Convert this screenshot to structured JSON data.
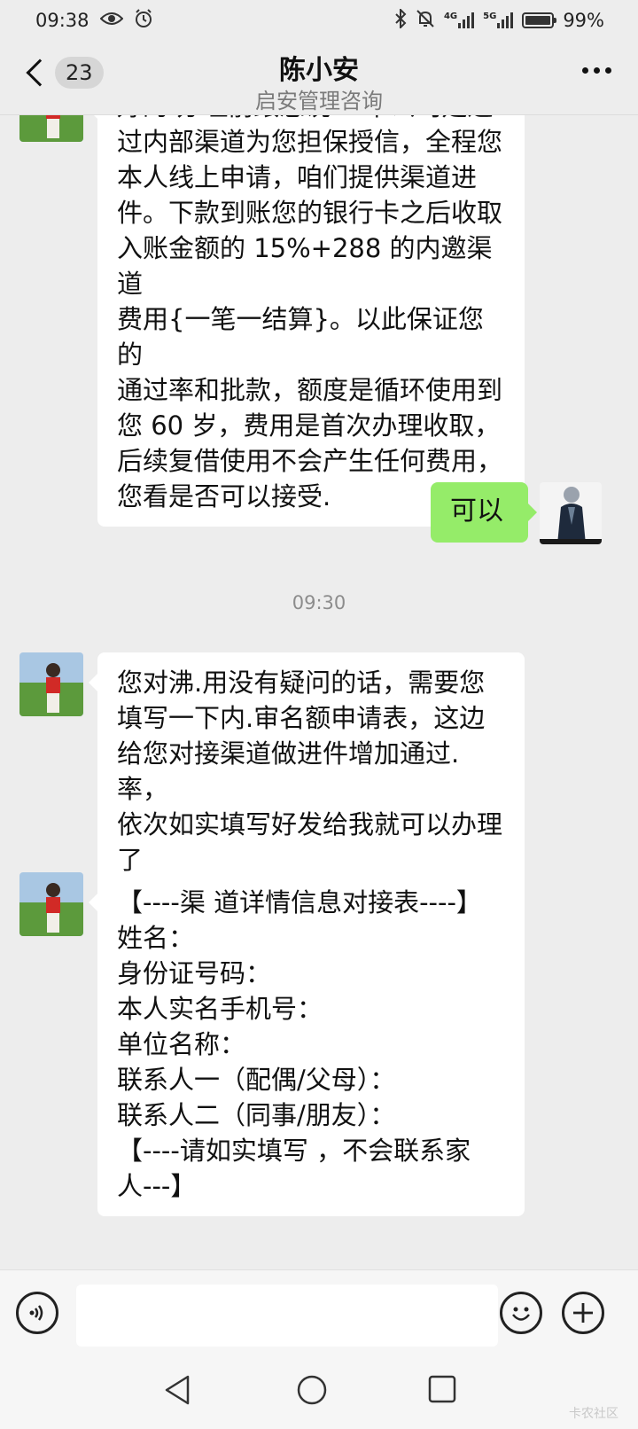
{
  "status_bar": {
    "time": "09:38",
    "battery_text": "99%",
    "network_1": "4G",
    "network_2": "5G",
    "battery_level_percent": 99
  },
  "header": {
    "back_badge": "23",
    "title": "陈小安",
    "subtitle": "启安管理咨询"
  },
  "messages": [
    {
      "side": "left",
      "text": "好的 办理前跟您说 一下公司是通\n过内部渠道为您担保授信，全程您\n本人线上申请，咱们提供渠道进\n件。下款到账您的银行卡之后收取\n入账金额的 15%+288 的内邀渠道\n费用{一笔一结算}。以此保证您的\n通过率和批款，额度是循环使用到\n您 60 岁，费用是首次办理收取，\n后续复借使用不会产生任何费用，\n您看是否可以接受."
    },
    {
      "side": "right",
      "text": "可以"
    },
    {
      "type": "time",
      "text": "09:30"
    },
    {
      "side": "left",
      "text": "您对沸.用没有疑问的话，需要您\n填写一下内.审名额申请表，这边\n给您对接渠道做进件增加通过.率，\n依次如实填写好发给我就可以办理\n了"
    },
    {
      "side": "left",
      "text": "【----渠 道详情信息对接表----】\n姓名：\n身份证号码：\n本人实名手机号：\n单位名称：\n联系人一（配偶/父母）：\n联系人二（同事/朋友）：\n【----请如实填写 ，不会联系家\n人---】"
    }
  ],
  "input": {
    "placeholder": ""
  },
  "watermark": "卡农社区",
  "colors": {
    "background": "#ededed",
    "bubble_self": "#95ec69",
    "bubble_other": "#ffffff"
  }
}
